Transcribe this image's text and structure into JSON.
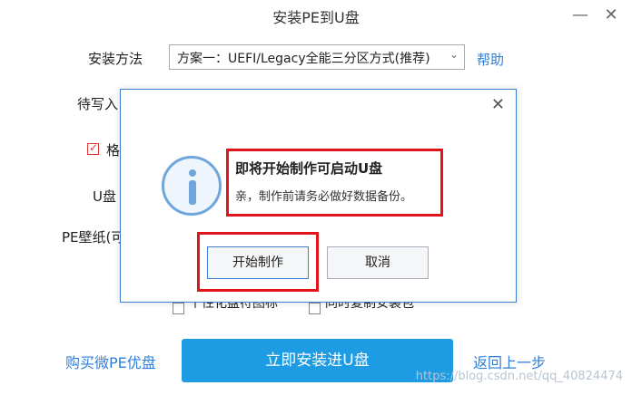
{
  "window": {
    "title": "安装PE到U盘",
    "minimize_glyph": "—",
    "close_glyph": "✕"
  },
  "form": {
    "install_method_label": "安装方法",
    "install_method_value": "方案一：UEFI/Legacy全能三分区方式(推荐)",
    "help_link": "帮助",
    "target_label_partial": "待写入",
    "format_label_partial": "格",
    "udisk_label_partial": "U盘",
    "wallpaper_label_partial": "PE壁纸(可",
    "option_personalize_partial": "个性化盘符图标",
    "option_copy_partial": "同时复制安装包"
  },
  "footer": {
    "buy_link": "购买微PE优盘",
    "install_button": "立即安装进U盘",
    "back_link": "返回上一步"
  },
  "dialog": {
    "close_glyph": "✕",
    "heading": "即将开始制作可启动U盘",
    "message": "亲，制作前请务必做好数据备份。",
    "start_button": "开始制作",
    "cancel_button": "取消"
  },
  "watermark": "https://blog.csdn.net/qq_40824474",
  "colors": {
    "accent": "#1d9be3",
    "highlight_red": "#e0141a",
    "link": "#2f7ed8"
  }
}
